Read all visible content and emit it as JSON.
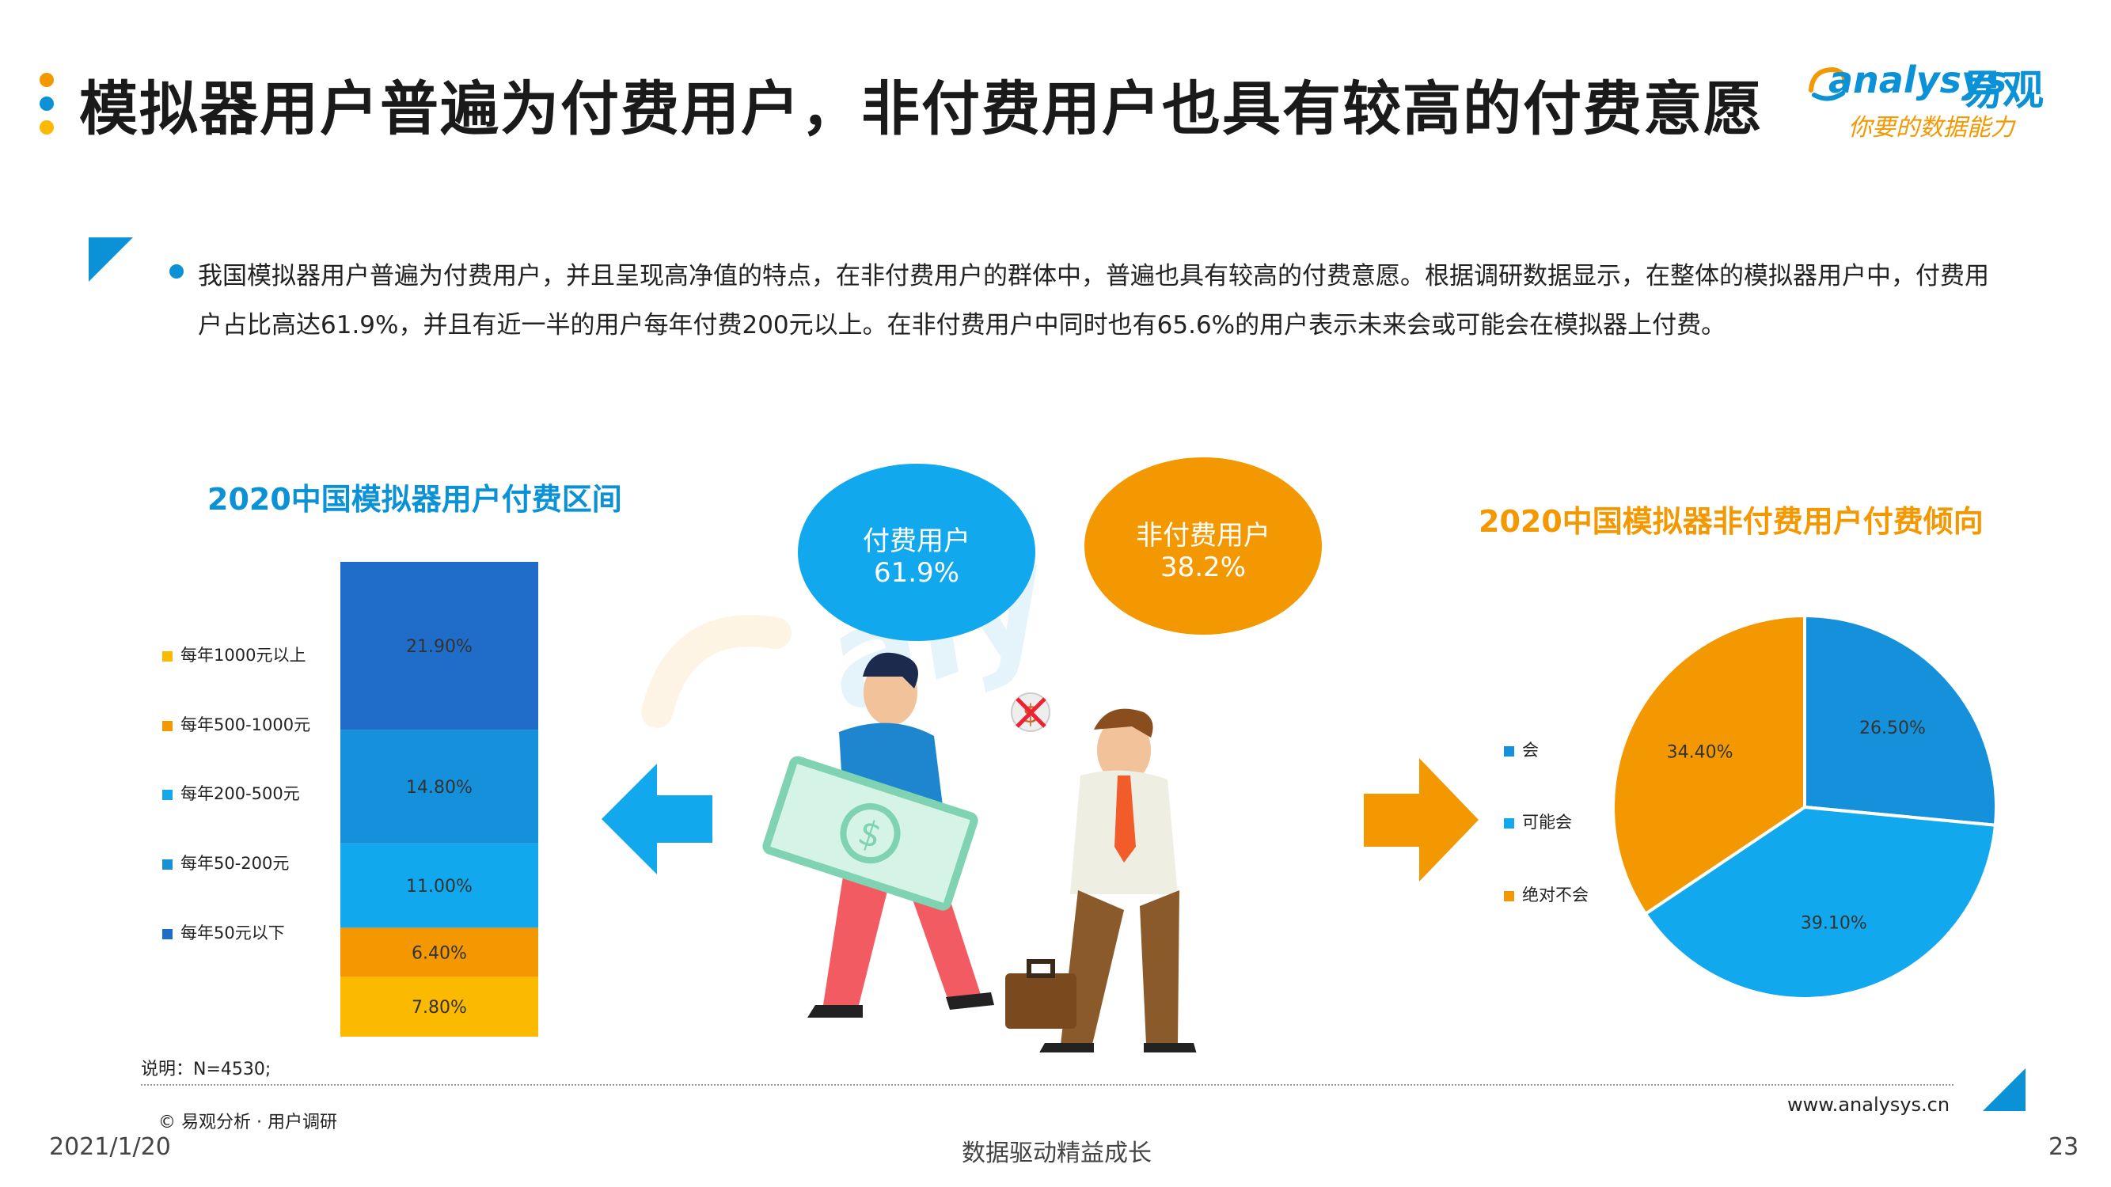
{
  "header": {
    "title": "模拟器用户普遍为付费用户，非付费用户也具有较高的付费意愿",
    "logo_en": "analysys",
    "logo_cn": "易观",
    "logo_slogan": "你要的数据能力"
  },
  "summary": {
    "text": "我国模拟器用户普遍为付费用户，并且呈现高净值的特点，在非付费用户的群体中，普遍也具有较高的付费意愿。根据调研数据显示，在整体的模拟器用户中，付费用户占比高达61.9%，并且有近一半的用户每年付费200元以上。在非付费用户中同时也有65.6%的用户表示未来会或可能会在模拟器上付费。"
  },
  "illustration": {
    "paying_label": "付费用户",
    "paying_value": "61.9%",
    "nonpaying_label": "非付费用户",
    "nonpaying_value": "38.2%",
    "dollar_symbol": "$"
  },
  "colors": {
    "blue": "#0a91d6",
    "orange": "#f39800",
    "dark_blue": "#1f6dc8",
    "mid_blue": "#1591db",
    "light_blue": "#11a8ee",
    "yellow": "#fbb900"
  },
  "chart_data": [
    {
      "type": "bar",
      "title": "2020中国模拟器用户付费区间",
      "stacked": true,
      "categories": [
        ""
      ],
      "series": [
        {
          "name": "每年50元以下",
          "values": [
            7.8
          ],
          "label": "7.80%",
          "color": "#fbb900"
        },
        {
          "name": "每年50-200元",
          "values": [
            6.4
          ],
          "label": "6.40%",
          "color": "#f39800"
        },
        {
          "name": "每年200-500元",
          "values": [
            11.0
          ],
          "label": "11.00%",
          "color": "#11a8ee"
        },
        {
          "name": "每年500-1000元",
          "values": [
            14.8
          ],
          "label": "14.80%",
          "color": "#1591db"
        },
        {
          "name": "每年1000元以上",
          "values": [
            21.9
          ],
          "label": "21.90%",
          "color": "#1f6dc8"
        }
      ],
      "legend": [
        {
          "label": "每年1000元以上",
          "color": "#fbb900"
        },
        {
          "label": "每年500-1000元",
          "color": "#f39800"
        },
        {
          "label": "每年200-500元",
          "color": "#11a8ee"
        },
        {
          "label": "每年50-200元",
          "color": "#1591db"
        },
        {
          "label": "每年50元以下",
          "color": "#1f6dc8"
        }
      ],
      "legend_position": "left"
    },
    {
      "type": "pie",
      "title": "2020中国模拟器非付费用户付费倾向",
      "slices": [
        {
          "name": "会",
          "value": 26.5,
          "label": "26.50%",
          "color": "#1591db"
        },
        {
          "name": "可能会",
          "value": 39.1,
          "label": "39.10%",
          "color": "#11a8ee"
        },
        {
          "name": "绝对不会",
          "value": 34.4,
          "label": "34.40%",
          "color": "#f39800"
        }
      ],
      "legend_position": "left"
    }
  ],
  "footer": {
    "note": "说明：N=4530;",
    "source": "© 易观分析 · 用户调研",
    "website": "www.analysys.cn",
    "date": "2021/1/20",
    "slogan": "数据驱动精益成长",
    "page": "23"
  }
}
